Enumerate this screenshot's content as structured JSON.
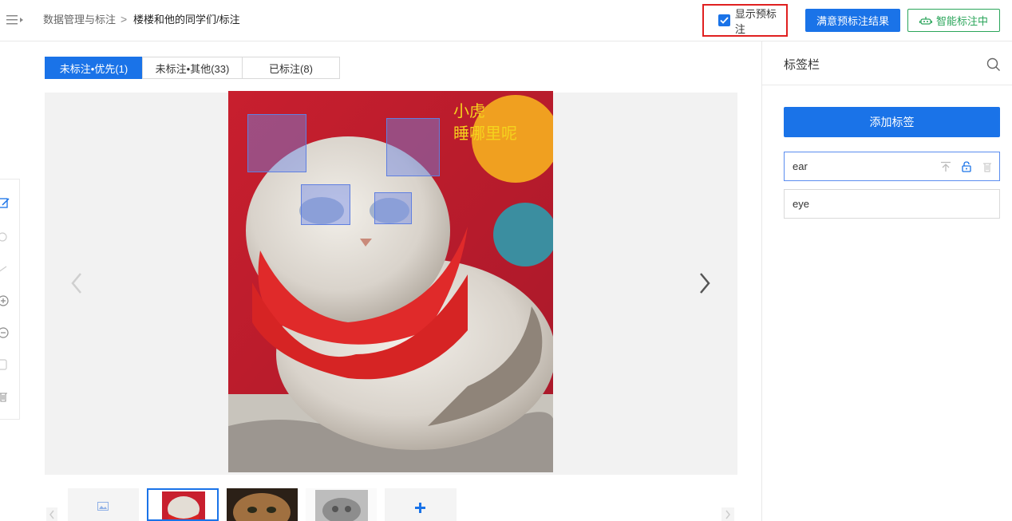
{
  "header": {
    "breadcrumb_root": "数据管理与标注",
    "breadcrumb_sep": ">",
    "breadcrumb_current": "楼楼和他的同学们/标注",
    "show_pre_label": "显示预标注",
    "show_pre_checked": true,
    "accept_button": "满意预标注结果",
    "smart_button": "智能标注中"
  },
  "tabs": [
    {
      "label": "未标注•优先(1)",
      "active": true
    },
    {
      "label": "未标注•其他(33)",
      "active": false
    },
    {
      "label": "已标注(8)",
      "active": false
    }
  ],
  "toolbar": [
    "edit-icon",
    "circle-icon",
    "line-icon",
    "zoom-in-icon",
    "zoom-out-icon",
    "square-icon",
    "trash-icon"
  ],
  "image": {
    "overlay_text_1": "小虎",
    "overlay_text_2": "睡哪里呢"
  },
  "thumbnails": [
    "placeholder-image",
    "cat-red-scarf",
    "tabby-kitten",
    "grey-cat",
    "add"
  ],
  "panel": {
    "title": "标签栏",
    "add_label_button": "添加标签",
    "labels": [
      {
        "name": "ear",
        "selected": true
      },
      {
        "name": "eye",
        "selected": false
      }
    ]
  },
  "colors": {
    "primary": "#1a73e8",
    "success": "#2aa55a",
    "highlight": "#e02020",
    "bbox": "#5f7fe0"
  }
}
